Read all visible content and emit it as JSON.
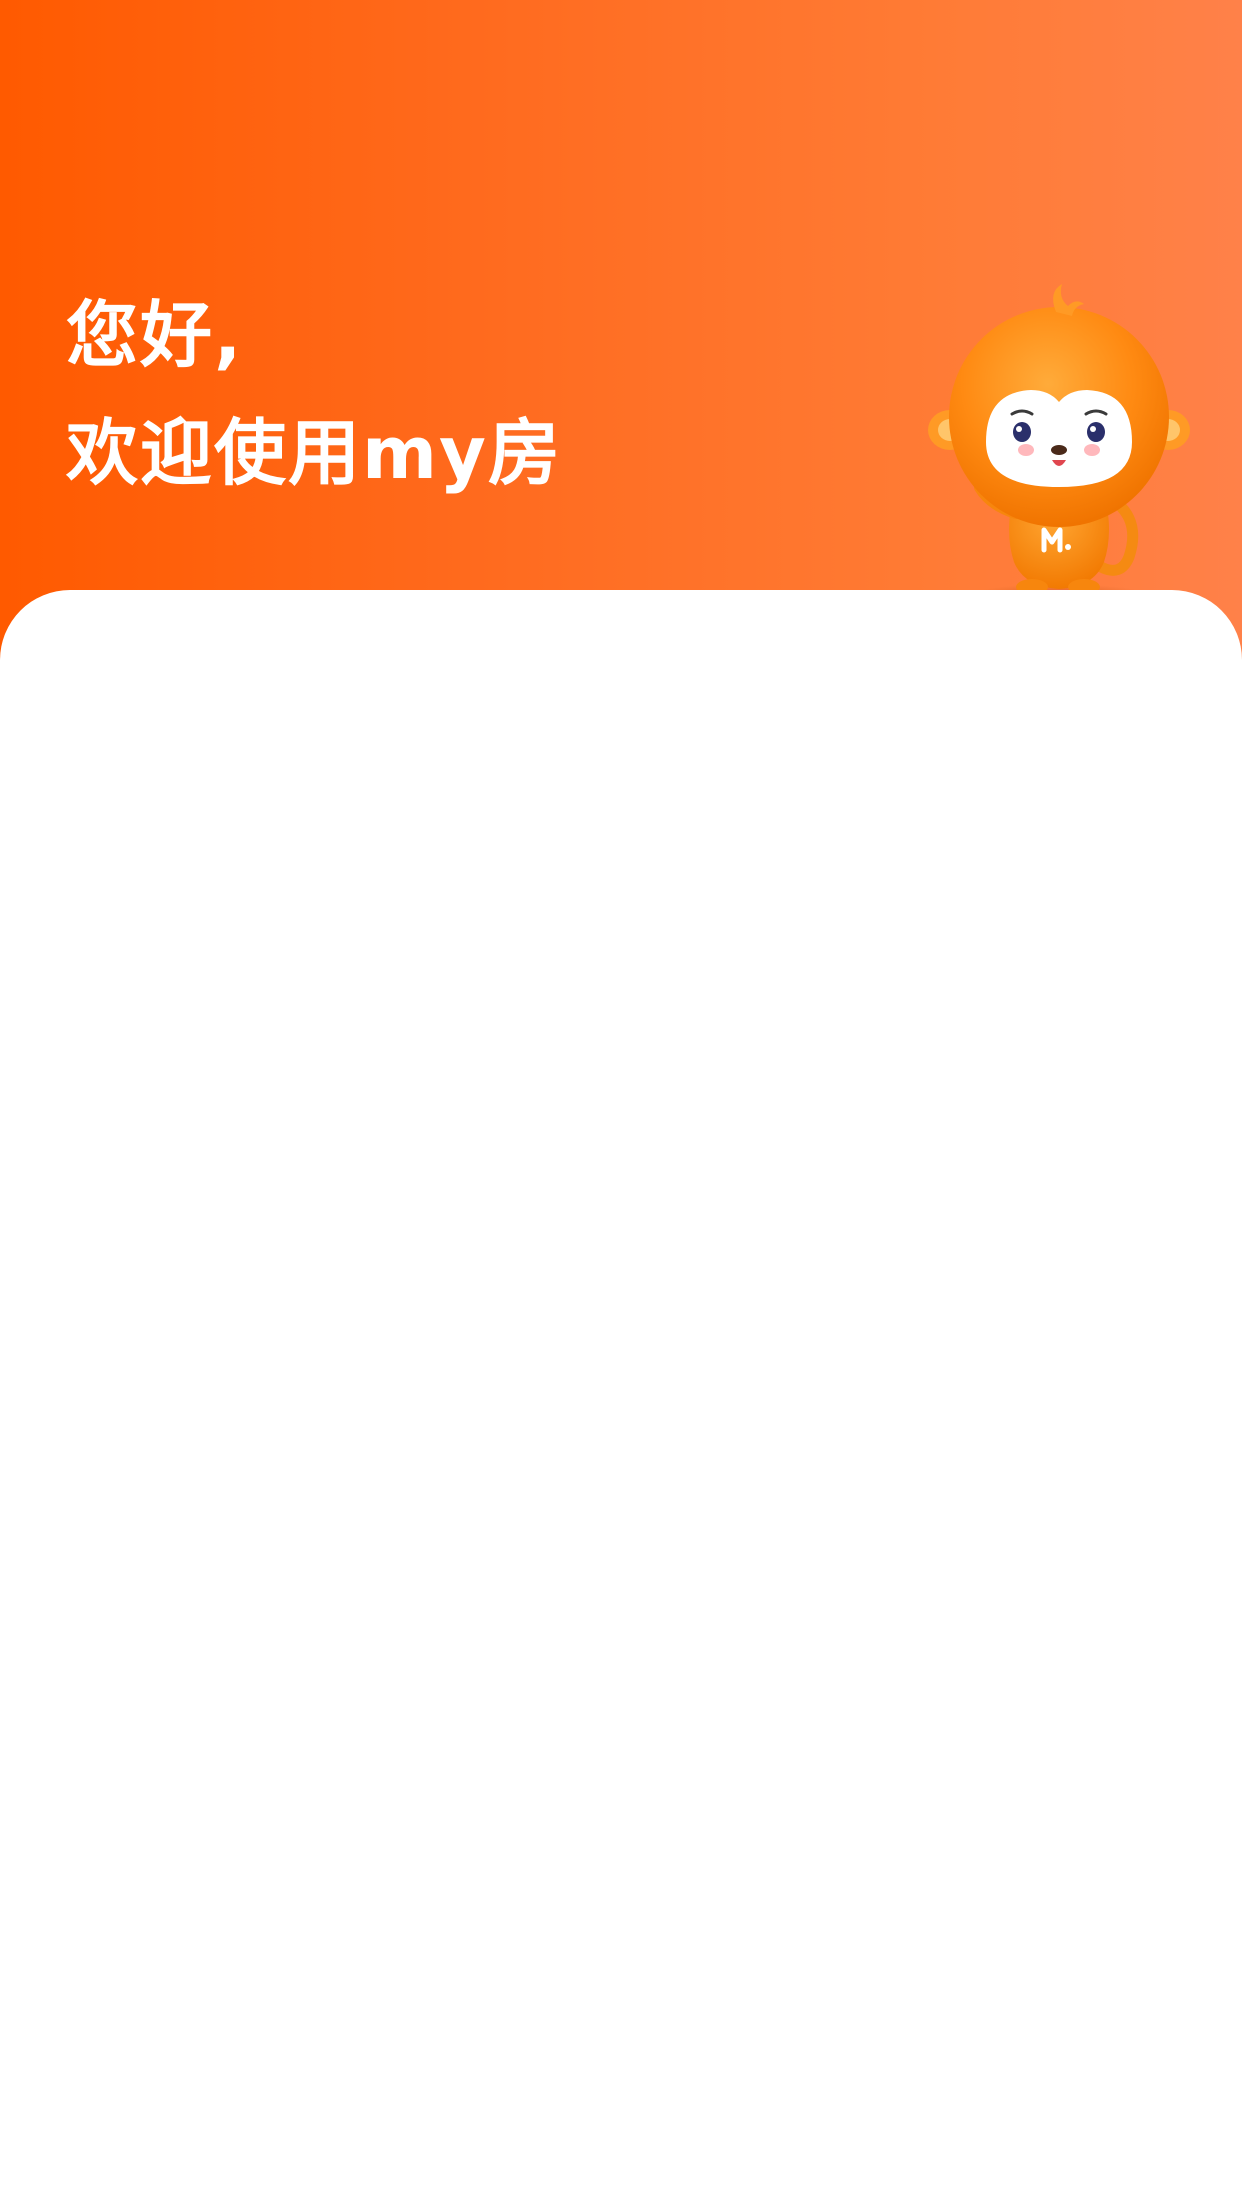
{
  "header": {
    "greeting_line1": "您好,",
    "greeting_line2": "欢迎使用my房"
  },
  "mascot": {
    "icon": "monkey-mascot-icon",
    "badge_letter": "M"
  },
  "colors": {
    "gradient_start": "#ff5a00",
    "gradient_end": "#ff8149",
    "card": "#ffffff",
    "text": "#ffffff"
  }
}
